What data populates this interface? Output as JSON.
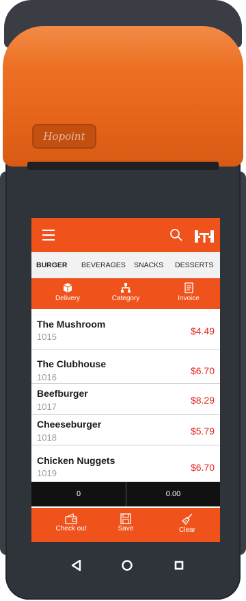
{
  "device": {
    "logo_text": "Hopoint"
  },
  "appbar": {
    "menu_icon": "menu-icon",
    "search_icon": "search-icon",
    "table_icon": "dining-table-icon"
  },
  "categories": [
    {
      "label": "BURGER",
      "active": true
    },
    {
      "label": "BEVERAGES",
      "active": false
    },
    {
      "label": "SNACKS",
      "active": false
    },
    {
      "label": "DESSERTS",
      "active": false
    }
  ],
  "actions": [
    {
      "label": "Delivery",
      "icon": "box-icon"
    },
    {
      "label": "Category",
      "icon": "sitemap-icon"
    },
    {
      "label": "Invoice",
      "icon": "invoice-icon"
    }
  ],
  "items": [
    {
      "name": "The Mushroom",
      "code": "1015",
      "price": "$4.49"
    },
    {
      "name": "The Clubhouse",
      "code": "1016",
      "price": "$6.70"
    },
    {
      "name": "Beefburger",
      "code": "1017",
      "price": "$8.29"
    },
    {
      "name": "Cheeseburger",
      "code": "1018",
      "price": "$5.79"
    },
    {
      "name": "Chicken Nuggets",
      "code": "1019",
      "price": "$6.70"
    }
  ],
  "totals": {
    "count": "0",
    "amount": "0.00"
  },
  "bottom_actions": [
    {
      "label": "Check out",
      "icon": "wallet-icon"
    },
    {
      "label": "Save",
      "icon": "save-icon"
    },
    {
      "label": "Clear",
      "icon": "broom-icon"
    }
  ],
  "nav": {
    "back": "back-icon",
    "home": "home-icon",
    "recent": "recent-apps-icon"
  },
  "colors": {
    "accent": "#f0521c",
    "price": "#e0251b",
    "totals_bg": "#111111",
    "device": "#2f333a"
  }
}
